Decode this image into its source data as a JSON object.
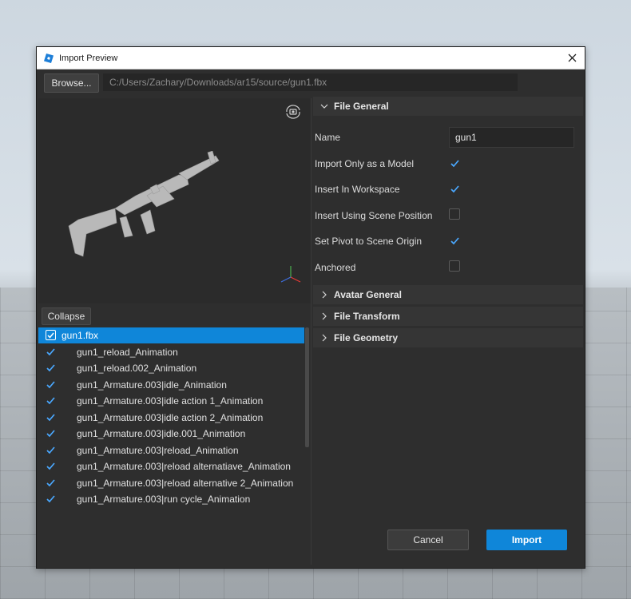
{
  "window": {
    "title": "Import Preview"
  },
  "toolbar": {
    "browse_label": "Browse...",
    "path": "C:/Users/Zachary/Downloads/ar15/source/gun1.fbx"
  },
  "tree": {
    "collapse_label": "Collapse",
    "root": {
      "label": "gun1.fbx",
      "checked": true
    },
    "items": [
      {
        "label": "gun1_reload_Animation",
        "checked": true
      },
      {
        "label": "gun1_reload.002_Animation",
        "checked": true
      },
      {
        "label": "gun1_Armature.003|idle_Animation",
        "checked": true
      },
      {
        "label": "gun1_Armature.003|idle action 1_Animation",
        "checked": true
      },
      {
        "label": "gun1_Armature.003|idle action 2_Animation",
        "checked": true
      },
      {
        "label": "gun1_Armature.003|idle.001_Animation",
        "checked": true
      },
      {
        "label": "gun1_Armature.003|reload_Animation",
        "checked": true
      },
      {
        "label": "gun1_Armature.003|reload alternatiave_Animation",
        "checked": true
      },
      {
        "label": "gun1_Armature.003|reload alternative 2_Animation",
        "checked": true
      },
      {
        "label": "gun1_Armature.003|run cycle_Animation",
        "checked": true
      }
    ]
  },
  "properties": {
    "file_general": {
      "title": "File General",
      "name_label": "Name",
      "name_value": "gun1",
      "checks": [
        {
          "label": "Import Only as a Model",
          "checked": true
        },
        {
          "label": "Insert In Workspace",
          "checked": true
        },
        {
          "label": "Insert Using Scene Position",
          "checked": false
        },
        {
          "label": "Set Pivot to Scene Origin",
          "checked": true
        },
        {
          "label": "Anchored",
          "checked": false
        }
      ]
    },
    "collapsed_sections": [
      {
        "title": "Avatar General"
      },
      {
        "title": "File Transform"
      },
      {
        "title": "File Geometry"
      }
    ]
  },
  "footer": {
    "cancel_label": "Cancel",
    "import_label": "Import"
  },
  "colors": {
    "accent": "#0f86d9",
    "panel": "#2e2e2e",
    "check": "#4aa8ff"
  }
}
